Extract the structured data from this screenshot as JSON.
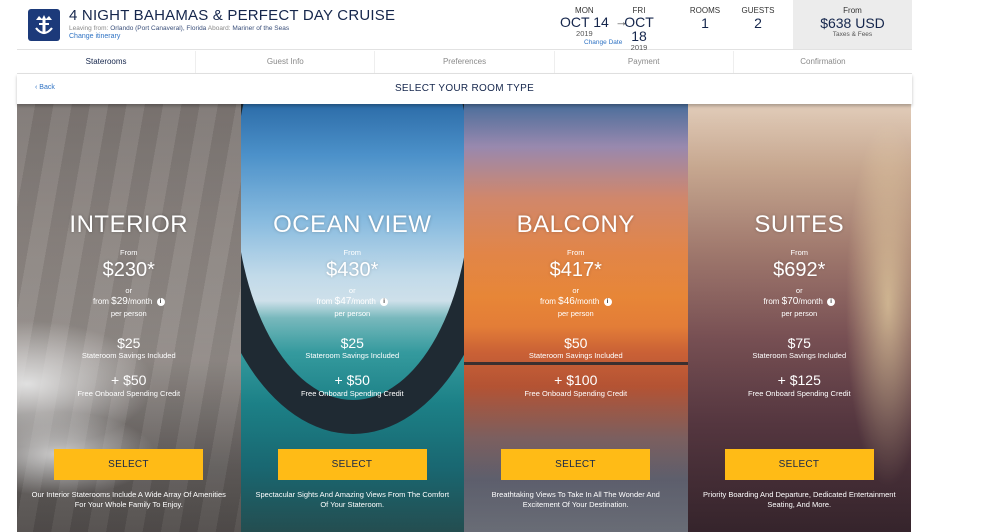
{
  "header": {
    "title": "4 NIGHT BAHAMAS & PERFECT DAY CRUISE",
    "leaving_label": "Leaving from:",
    "leaving_value": "Orlando (Port Canaveral), Florida",
    "aboard_label": "Aboard:",
    "aboard_value": "Mariner of the Seas",
    "change_itinerary": "Change itinerary",
    "start": {
      "dow": "MON",
      "date": "OCT 14",
      "year": "2019"
    },
    "end": {
      "dow": "FRI",
      "date": "OCT 18",
      "year": "2019"
    },
    "change_date": "Change Date",
    "rooms_label": "ROOMS",
    "rooms_value": "1",
    "guests_label": "GUESTS",
    "guests_value": "2",
    "price_from": "From",
    "price_amount": "$638 USD",
    "price_note": "Taxes & Fees"
  },
  "steps": [
    "Staterooms",
    "Guest Info",
    "Preferences",
    "Payment",
    "Confirmation"
  ],
  "bar": {
    "back": "Back",
    "title": "SELECT YOUR ROOM TYPE"
  },
  "cards": [
    {
      "name": "INTERIOR",
      "from": "From",
      "price": "$230*",
      "or": "or",
      "month_prefix": "from",
      "month_price": "$29",
      "month_suffix": "/month",
      "per_person": "per person",
      "savings": "$25",
      "savings_label": "Stateroom Savings Included",
      "credit": "+ $50",
      "credit_label": "Free Onboard Spending Credit",
      "button": "SELECT",
      "description": "Our Interior Staterooms Include A Wide Array Of Amenities For Your Whole Family To Enjoy."
    },
    {
      "name": "OCEAN VIEW",
      "from": "From",
      "price": "$430*",
      "or": "or",
      "month_prefix": "from",
      "month_price": "$47",
      "month_suffix": "/month",
      "per_person": "per person",
      "savings": "$25",
      "savings_label": "Stateroom Savings Included",
      "credit": "+ $50",
      "credit_label": "Free Onboard Spending Credit",
      "button": "SELECT",
      "description": "Spectacular Sights And Amazing Views From The Comfort Of Your Stateroom."
    },
    {
      "name": "BALCONY",
      "from": "From",
      "price": "$417*",
      "or": "or",
      "month_prefix": "from",
      "month_price": "$46",
      "month_suffix": "/month",
      "per_person": "per person",
      "savings": "$50",
      "savings_label": "Stateroom Savings Included",
      "credit": "+ $100",
      "credit_label": "Free Onboard Spending Credit",
      "button": "SELECT",
      "description": "Breathtaking Views To Take In All The Wonder And Excitement Of Your Destination."
    },
    {
      "name": "SUITES",
      "from": "From",
      "price": "$692*",
      "or": "or",
      "month_prefix": "from",
      "month_price": "$70",
      "month_suffix": "/month",
      "per_person": "per person",
      "savings": "$75",
      "savings_label": "Stateroom Savings Included",
      "credit": "+ $125",
      "credit_label": "Free Onboard Spending Credit",
      "button": "SELECT",
      "description": "Priority Boarding And Departure, Dedicated Entertainment Seating, And More."
    }
  ],
  "colors": {
    "brand": "#15264c",
    "link": "#2f73c4",
    "button": "#ffbb16"
  },
  "icons": {
    "logo": "crown-anchor-logo",
    "arrow": "right-arrow-icon",
    "info": "info-icon",
    "back": "chevron-left-icon"
  }
}
